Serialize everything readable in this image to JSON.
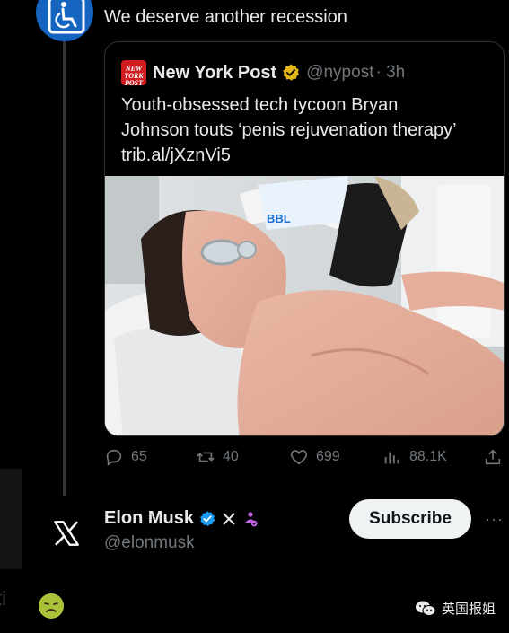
{
  "tweet": {
    "text": "We deserve another recession"
  },
  "quote": {
    "logo_text": "NEW YORK POST",
    "author_name": "New York Post",
    "handle": "@nypost",
    "time": "· 3h",
    "body_line1": "Youth-obsessed tech tycoon Bryan",
    "body_line2": "Johnson touts ‘penis rejuvenation therapy’",
    "link": "trib.al/jXznVi5",
    "image_device_label": "BBL"
  },
  "actions": {
    "replies": "65",
    "reposts": "40",
    "likes": "699",
    "views": "88.1K"
  },
  "author": {
    "name": "Elon Musk",
    "handle": "@elonmusk",
    "subscribe_label": "Subscribe",
    "more": "···"
  },
  "watermark": {
    "text": "英国报姐"
  },
  "colors": {
    "background": "#000000",
    "text": "#e7e9ea",
    "muted": "#71767b",
    "verified_blue": "#1d9bf0",
    "verified_gold": "#e2b719",
    "nypost_red": "#d01c1f",
    "affiliate_purple": "#c264e6"
  },
  "icons": [
    "wheelchair-icon",
    "verified-gold-icon",
    "reply-icon",
    "repost-icon",
    "like-icon",
    "views-icon",
    "share-icon",
    "x-logo-icon",
    "verified-blue-icon",
    "x-affiliate-icon",
    "affiliate-badge-icon",
    "sick-face-icon",
    "wechat-icon"
  ]
}
